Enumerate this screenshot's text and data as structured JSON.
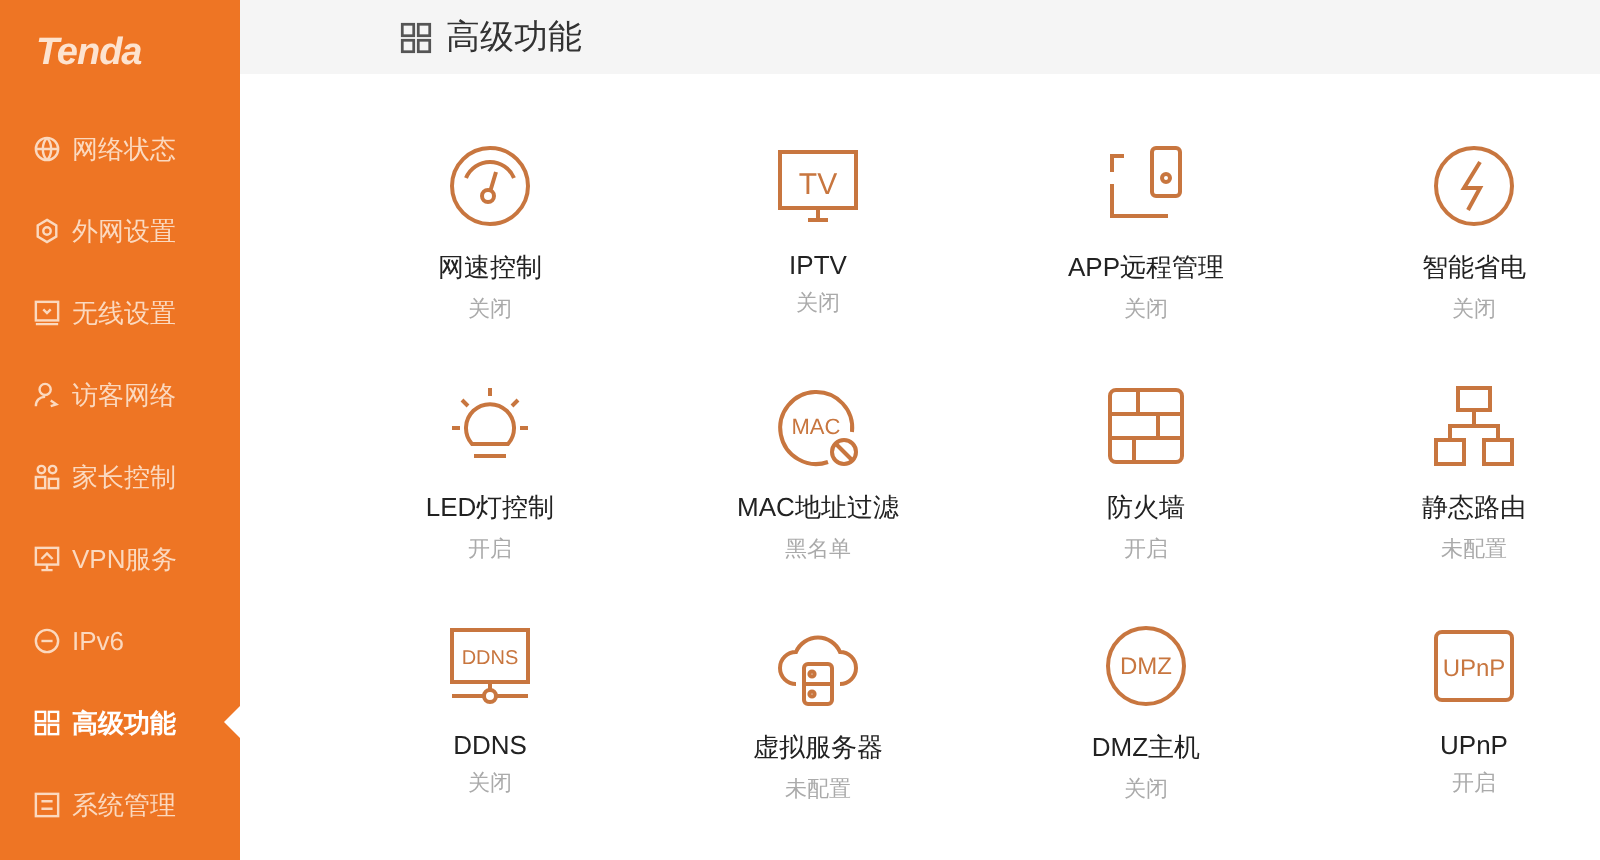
{
  "sidebar": {
    "logo": "Tenda",
    "items": [
      {
        "label": "网络状态",
        "selected": false
      },
      {
        "label": "外网设置",
        "selected": false
      },
      {
        "label": "无线设置",
        "selected": false
      },
      {
        "label": "访客网络",
        "selected": false
      },
      {
        "label": "家长控制",
        "selected": false
      },
      {
        "label": "VPN服务",
        "selected": false
      },
      {
        "label": "IPv6",
        "selected": false
      },
      {
        "label": "高级功能",
        "selected": true
      },
      {
        "label": "系统管理",
        "selected": false
      }
    ]
  },
  "header": {
    "title": "高级功能"
  },
  "features": [
    {
      "name": "网速控制",
      "status": "关闭"
    },
    {
      "name": "IPTV",
      "status": "关闭",
      "icon_text": "TV"
    },
    {
      "name": "APP远程管理",
      "status": "关闭"
    },
    {
      "name": "智能省电",
      "status": "关闭"
    },
    {
      "name": "LED灯控制",
      "status": "开启"
    },
    {
      "name": "MAC地址过滤",
      "status": "黑名单",
      "icon_text": "MAC"
    },
    {
      "name": "防火墙",
      "status": "开启"
    },
    {
      "name": "静态路由",
      "status": "未配置"
    },
    {
      "name": "DDNS",
      "status": "关闭",
      "icon_text": "DDNS"
    },
    {
      "name": "虚拟服务器",
      "status": "未配置"
    },
    {
      "name": "DMZ主机",
      "status": "关闭",
      "icon_text": "DMZ"
    },
    {
      "name": "UPnP",
      "status": "开启",
      "icon_text": "UPnP"
    }
  ]
}
